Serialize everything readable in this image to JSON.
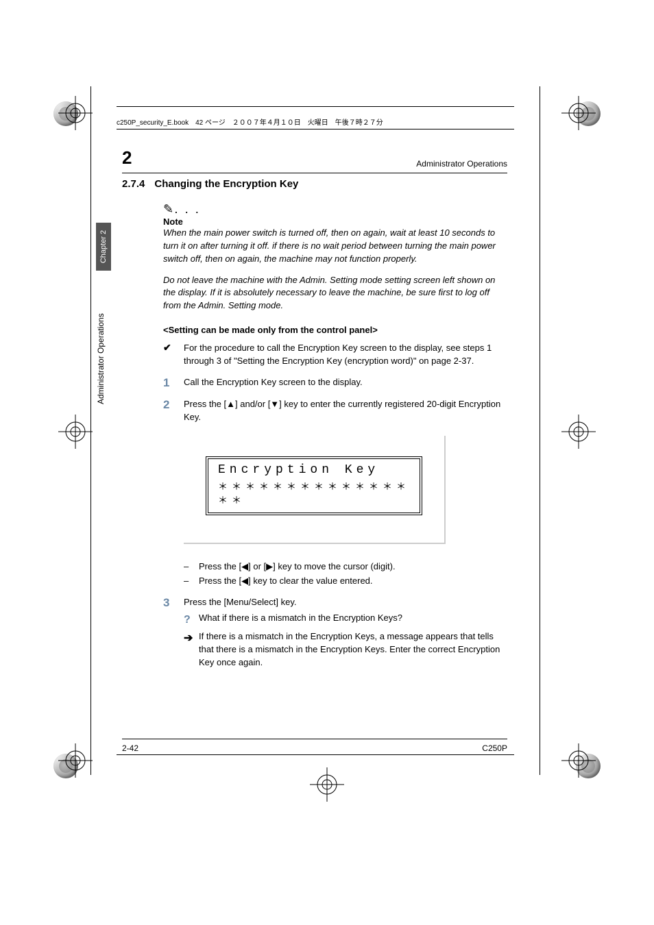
{
  "meta_line": "c250P_security_E.book　42 ページ　２００７年４月１０日　火曜日　午後７時２７分",
  "chapter_number": "2",
  "header_right": "Administrator Operations",
  "sideband": "Chapter 2",
  "sidetext": "Administrator Operations",
  "section": {
    "number": "2.7.4",
    "title": "Changing the Encryption Key"
  },
  "note": {
    "label": "Note",
    "p1": "When the main power switch is turned off, then on again, wait at least 10 seconds to turn it on after turning it off. if there is no wait period between turning the main power switch off, then on again, the machine may not function properly.",
    "p2": "Do not leave the machine with the Admin. Setting mode setting screen left shown on the display. If it is absolutely necessary to leave the machine, be sure first to log off from the Admin. Setting mode."
  },
  "subhead": "<Setting can be made only from the control panel>",
  "check_item": "For the procedure to call the Encryption Key screen to the display, see steps 1 through 3 of \"Setting the Encryption Key (encryption word)\" on page 2-37.",
  "steps": {
    "s1": "Call the Encryption Key screen to the display.",
    "s2": "Press the [▲] and/or [▼] key to enter the currently registered 20-digit Encryption Key.",
    "s2_sub1": "Press the [◀] or [▶] key to move the cursor (digit).",
    "s2_sub2": "Press the [◀] key to clear the value entered.",
    "s3": "Press the [Menu/Select] key.",
    "s3_q": "What if there is a mismatch in the Encryption Keys?",
    "s3_a": "If there is a mismatch in the Encryption Keys, a message appears that tells that there is a mismatch in the Encryption Keys. Enter the correct Encryption Key once again."
  },
  "lcd": {
    "line1": "Encryption Key",
    "line2": "＊＊＊＊＊＊＊＊＊＊＊＊＊＊＊＊"
  },
  "footer": {
    "left": "2-42",
    "right": "C250P"
  },
  "marks": {
    "n1": "1",
    "n2": "2",
    "n3": "3",
    "dash": "–",
    "q": "?",
    "arrow": "➔",
    "check": "✔",
    "dots": ". . ."
  }
}
